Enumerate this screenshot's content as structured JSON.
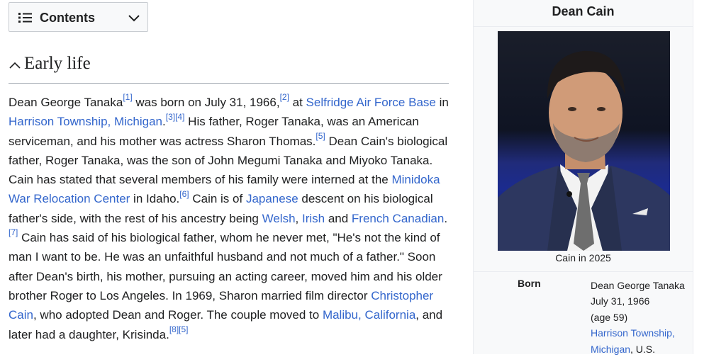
{
  "toc": {
    "label": "Contents",
    "icon": "list-icon",
    "toggle_icon": "chevron-down-icon"
  },
  "section": {
    "heading": "Early life",
    "collapse_icon": "chevron-up-icon"
  },
  "paragraph": {
    "s1": "Dean George Tanaka",
    "r1": "[1]",
    "s2": " was born on July 31, 1966,",
    "r2": "[2]",
    "s3": " at ",
    "l1": "Selfridge Air Force Base",
    "s4": " in ",
    "l2": "Harrison Township, Michigan",
    "s5": ".",
    "r3": "[3][4]",
    "s6": " His father, Roger Tanaka, was an American serviceman, and his mother was actress Sharon Thomas.",
    "r4": "[5]",
    "s7": " Dean Cain's biological father, Roger Tanaka, was the son of John Megumi Tanaka and Miyoko Tanaka. Cain has stated that several members of his family were interned at the ",
    "l3": "Minidoka War Relocation Center",
    "s8": " in Idaho.",
    "r5": "[6]",
    "s9": " Cain is of ",
    "l4": "Japanese",
    "s10": " descent on his biological father's side, with the rest of his ancestry being ",
    "l5": "Welsh",
    "s11": ", ",
    "l6": "Irish",
    "s12": " and ",
    "l7": "French Canadian",
    "s13": ".",
    "r6": "[7]",
    "s14": " Cain has said of his biological father, whom he never met, \"He's not the kind of man I want to be. He was an unfaithful husband and not much of a father.\" Soon after Dean's birth, his mother, pursuing an acting career, moved him and his older brother Roger to Los Angeles. In 1969, Sharon married film director ",
    "l8": "Christopher Cain",
    "s15": ", who adopted Dean and Roger. The couple moved to ",
    "l9": "Malibu, California",
    "s16": ", and later had a daughter, Krisinda.",
    "r7": "[8][5]"
  },
  "infobox": {
    "title": "Dean Cain",
    "caption": "Cain in 2025",
    "born_label": "Born",
    "born_name": "Dean George Tanaka",
    "born_date": "July 31, 1966",
    "born_age": "(age 59)",
    "born_place_link": "Harrison Township, Michigan",
    "born_place_suffix": ", U.S."
  }
}
